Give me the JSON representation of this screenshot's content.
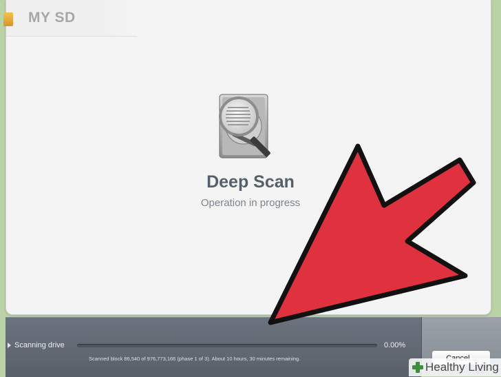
{
  "window": {
    "title": "MY SD"
  },
  "main": {
    "icon": "hard-drive-magnifier-icon",
    "heading": "Deep Scan",
    "subheading": "Operation in progress"
  },
  "progress": {
    "label": "Scanning drive",
    "percent_text": "0.00%",
    "fraction": 0.0,
    "detail": "Scanned block 86,540 of 976,773,166 (phase 1 of 3). About 10 hours, 30 minutes remaining.",
    "cancel_label": "Cancel..."
  },
  "overlay": {
    "arrow_color": "#e0313f",
    "arrow_outline": "#111111"
  },
  "watermark": {
    "text": "Healthy Living",
    "icon": "plus-icon",
    "icon_color": "#3c8f3c"
  }
}
